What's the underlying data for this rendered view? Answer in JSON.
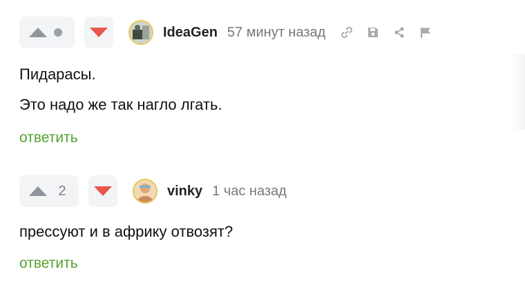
{
  "comments": [
    {
      "rating_count": "",
      "username": "IdeaGen",
      "time": "57 минут назад",
      "paragraphs": [
        "Пидарасы.",
        "Это надо же так нагло лгать."
      ],
      "reply_label": "ответить",
      "icons": [
        "vote-up-icon",
        "rating-dot-icon",
        "vote-down-icon",
        "link-icon",
        "save-icon",
        "share-icon",
        "flag-icon"
      ]
    },
    {
      "rating_count": "2",
      "username": "vinky",
      "time": "1 час назад",
      "paragraphs": [
        "прессуют и в африку отвозят?"
      ],
      "reply_label": "ответить",
      "icons": [
        "vote-up-icon",
        "vote-down-icon"
      ]
    }
  ],
  "colors": {
    "vote_up": "#8f959c",
    "vote_down": "#e8574a",
    "reply_link": "#54a230",
    "rating_bg": "#f3f4f6"
  }
}
